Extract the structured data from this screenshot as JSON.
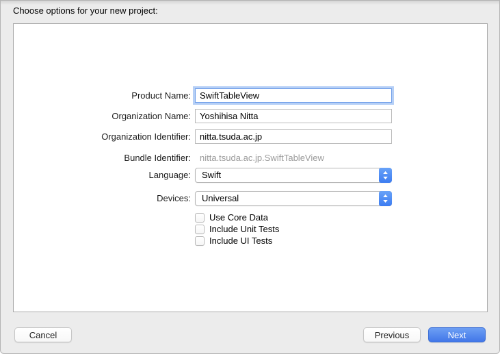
{
  "window": {
    "title": "Choose options for your new project:"
  },
  "form": {
    "rows": [
      {
        "label": "Product Name:",
        "value": "SwiftTableView",
        "type": "text",
        "focused": true
      },
      {
        "label": "Organization Name:",
        "value": "Yoshihisa Nitta",
        "type": "text",
        "focused": false
      },
      {
        "label": "Organization Identifier:",
        "value": "nitta.tsuda.ac.jp",
        "type": "text",
        "focused": false
      },
      {
        "label": "Bundle Identifier:",
        "value": "nitta.tsuda.ac.jp.SwiftTableView",
        "type": "static",
        "focused": false
      },
      {
        "label": "Language:",
        "value": "Swift",
        "type": "select",
        "focused": false
      },
      {
        "label": "Devices:",
        "value": "Universal",
        "type": "select",
        "focused": false
      }
    ],
    "checkboxes": [
      {
        "label": "Use Core Data",
        "checked": false
      },
      {
        "label": "Include Unit Tests",
        "checked": false
      },
      {
        "label": "Include UI Tests",
        "checked": false
      }
    ]
  },
  "footer": {
    "cancel": "Cancel",
    "previous": "Previous",
    "next": "Next"
  },
  "colors": {
    "window_bg": "#ececec",
    "accent_blue": "#4277e8",
    "focus_ring": "#78a7ee",
    "muted_text": "#9b9b9b"
  },
  "icons": {
    "popup_chevrons": "chevron-up-down"
  }
}
